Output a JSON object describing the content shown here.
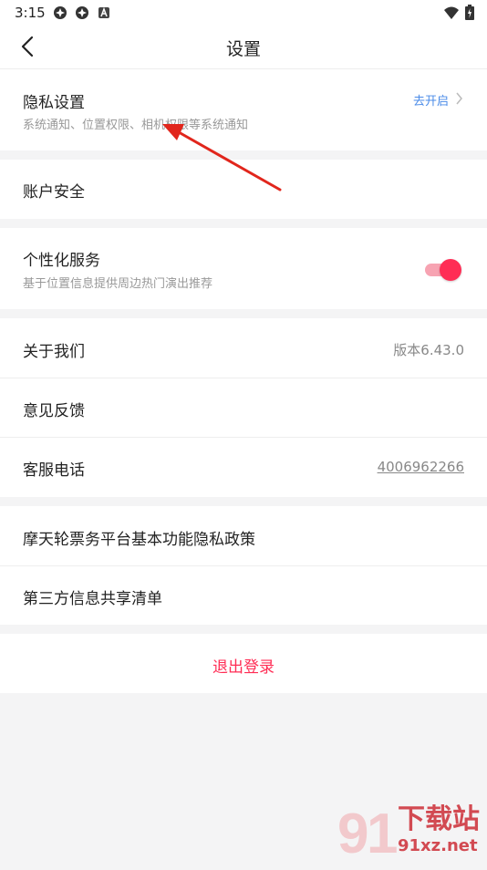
{
  "status": {
    "time": "3:15"
  },
  "header": {
    "title": "设置"
  },
  "privacy": {
    "label": "隐私设置",
    "sub": "系统通知、位置权限、相机权限等系统通知",
    "action": "去开启"
  },
  "account": {
    "label": "账户安全"
  },
  "personal": {
    "label": "个性化服务",
    "sub": "基于位置信息提供周边热门演出推荐",
    "enabled": true
  },
  "about": {
    "label": "关于我们",
    "version": "版本6.43.0"
  },
  "feedback": {
    "label": "意见反馈"
  },
  "service": {
    "label": "客服电话",
    "phone": "4006962266"
  },
  "policy": {
    "label": "摩天轮票务平台基本功能隐私政策"
  },
  "share": {
    "label": "第三方信息共享清单"
  },
  "logout": {
    "label": "退出登录"
  },
  "watermark": {
    "big": "下载站",
    "small": "91xz.net"
  },
  "colors": {
    "accent": "#ff2d55",
    "link": "#3d6df2",
    "action": "#4a8be8"
  }
}
